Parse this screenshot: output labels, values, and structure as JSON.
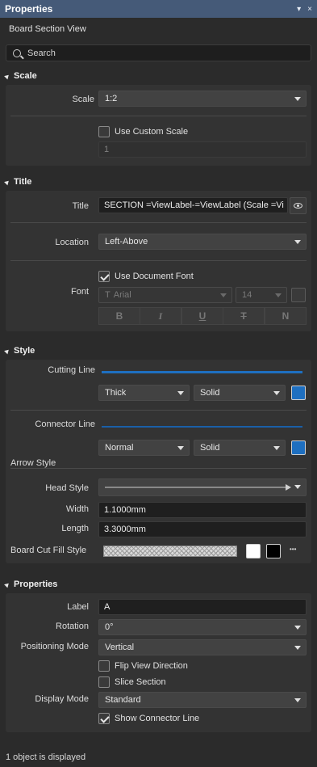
{
  "window": {
    "title": "Properties",
    "pin_glyph": "▾",
    "close_glyph": "×"
  },
  "subtitle": "Board Section View",
  "search": {
    "placeholder": "Search"
  },
  "sections": {
    "scale": {
      "header": "Scale",
      "scale_label": "Scale",
      "scale_value": "1:2",
      "use_custom_label": "Use Custom Scale",
      "use_custom_checked": false,
      "custom_value": "1"
    },
    "title": {
      "header": "Title",
      "title_label": "Title",
      "title_value": "SECTION =ViewLabel-=ViewLabel (Scale =Vi",
      "location_label": "Location",
      "location_value": "Left-Above",
      "font_label": "Font",
      "use_doc_font_label": "Use Document Font",
      "use_doc_font_checked": true,
      "font_family": "Arial",
      "font_glyph": "T",
      "font_size": "14",
      "format_buttons": [
        "B",
        "I",
        "U",
        "T",
        "N"
      ]
    },
    "style": {
      "header": "Style",
      "cutting_line_label": "Cutting Line",
      "cutting_weight": "Thick",
      "cutting_style": "Solid",
      "connector_line_label": "Connector Line",
      "connector_weight": "Normal",
      "connector_style": "Solid",
      "line_color": "#1e6fc0",
      "arrow_style_label": "Arrow Style",
      "head_style_label": "Head Style",
      "width_label": "Width",
      "width_value": "1.1000mm",
      "length_label": "Length",
      "length_value": "3.3000mm",
      "fill_style_label": "Board Cut Fill Style",
      "more_glyph": "•••"
    },
    "properties": {
      "header": "Properties",
      "label_label": "Label",
      "label_value": "A",
      "rotation_label": "Rotation",
      "rotation_value": "0°",
      "positioning_label": "Positioning Mode",
      "positioning_value": "Vertical",
      "flip_label": "Flip View Direction",
      "flip_checked": false,
      "slice_label": "Slice Section",
      "slice_checked": false,
      "display_label": "Display Mode",
      "display_value": "Standard",
      "show_connector_label": "Show Connector Line",
      "show_connector_checked": true
    }
  },
  "status": "1 object is displayed"
}
